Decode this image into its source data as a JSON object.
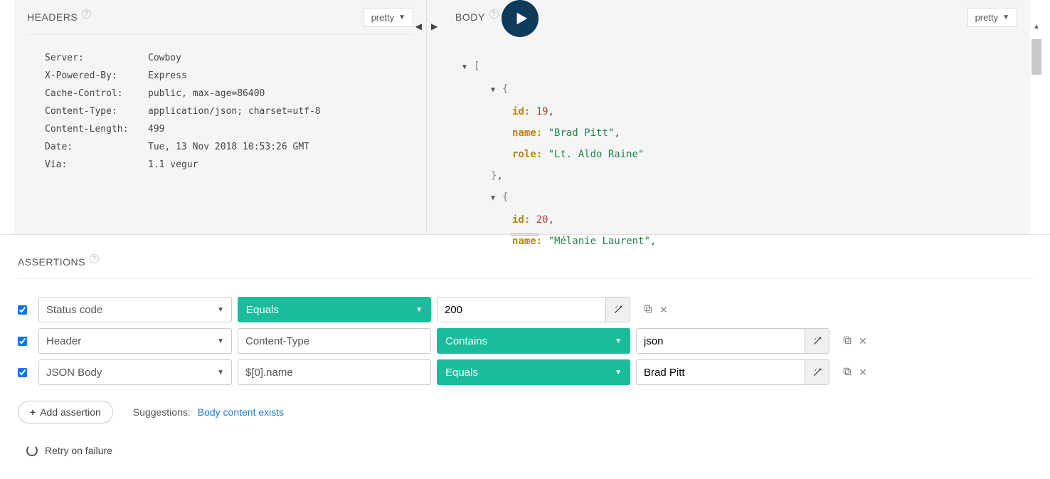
{
  "panels": {
    "headers_title": "HEADERS",
    "body_title": "BODY",
    "view_mode": "pretty"
  },
  "headers": [
    {
      "key": "Server:",
      "value": "Cowboy"
    },
    {
      "key": "X-Powered-By:",
      "value": "Express"
    },
    {
      "key": "Cache-Control:",
      "value": "public, max-age=86400"
    },
    {
      "key": "Content-Type:",
      "value": "application/json; charset=utf-8"
    },
    {
      "key": "Content-Length:",
      "value": "499"
    },
    {
      "key": "Date:",
      "value": "Tue, 13 Nov 2018 10:53:26 GMT"
    },
    {
      "key": "Via:",
      "value": "1.1 vegur"
    }
  ],
  "body": {
    "items": [
      {
        "id": "19",
        "name": "\"Brad Pitt\"",
        "role": "\"Lt. Aldo Raine\""
      },
      {
        "id": "20",
        "name": "\"Mélanie Laurent\""
      }
    ],
    "keys": {
      "id": "id:",
      "name": "name:",
      "role": "role:"
    }
  },
  "assertions": {
    "title": "ASSERTIONS",
    "rows": [
      {
        "checked": true,
        "source": "Status code",
        "property": "",
        "comparison": "Equals",
        "target": "200",
        "has_property": false
      },
      {
        "checked": true,
        "source": "Header",
        "property": "Content-Type",
        "comparison": "Contains",
        "target": "json",
        "has_property": true
      },
      {
        "checked": true,
        "source": "JSON Body",
        "property": "$[0].name",
        "comparison": "Equals",
        "target": "Brad Pitt",
        "has_property": true
      }
    ],
    "add_label": "Add assertion",
    "suggestions_label": "Suggestions:",
    "suggestion_link": "Body content exists",
    "retry_label": "Retry on failure"
  }
}
